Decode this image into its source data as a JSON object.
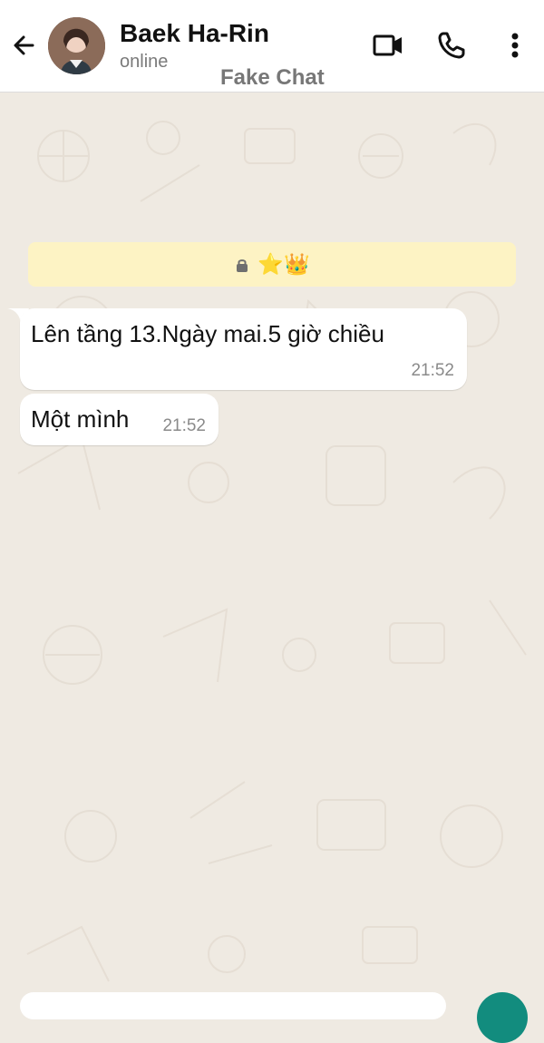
{
  "header": {
    "contact_name": "Baek Ha-Rin",
    "status": "online",
    "watermark": "Fake Chat"
  },
  "encryption_notice": {
    "emoji": "⭐👑"
  },
  "messages": [
    {
      "text": "Lên tầng 13.Ngày mai.5 giờ chiều",
      "time": "21:52"
    },
    {
      "text": "Một mình",
      "time": "21:52"
    }
  ],
  "icons": {
    "back": "arrow-left-icon",
    "video": "video-call-icon",
    "call": "phone-icon",
    "more": "more-vertical-icon",
    "lock": "lock-icon"
  },
  "colors": {
    "chat_background": "#efeae2",
    "encryption_banner": "#fdf3c4",
    "bubble": "#ffffff",
    "accent": "#128c7e"
  }
}
